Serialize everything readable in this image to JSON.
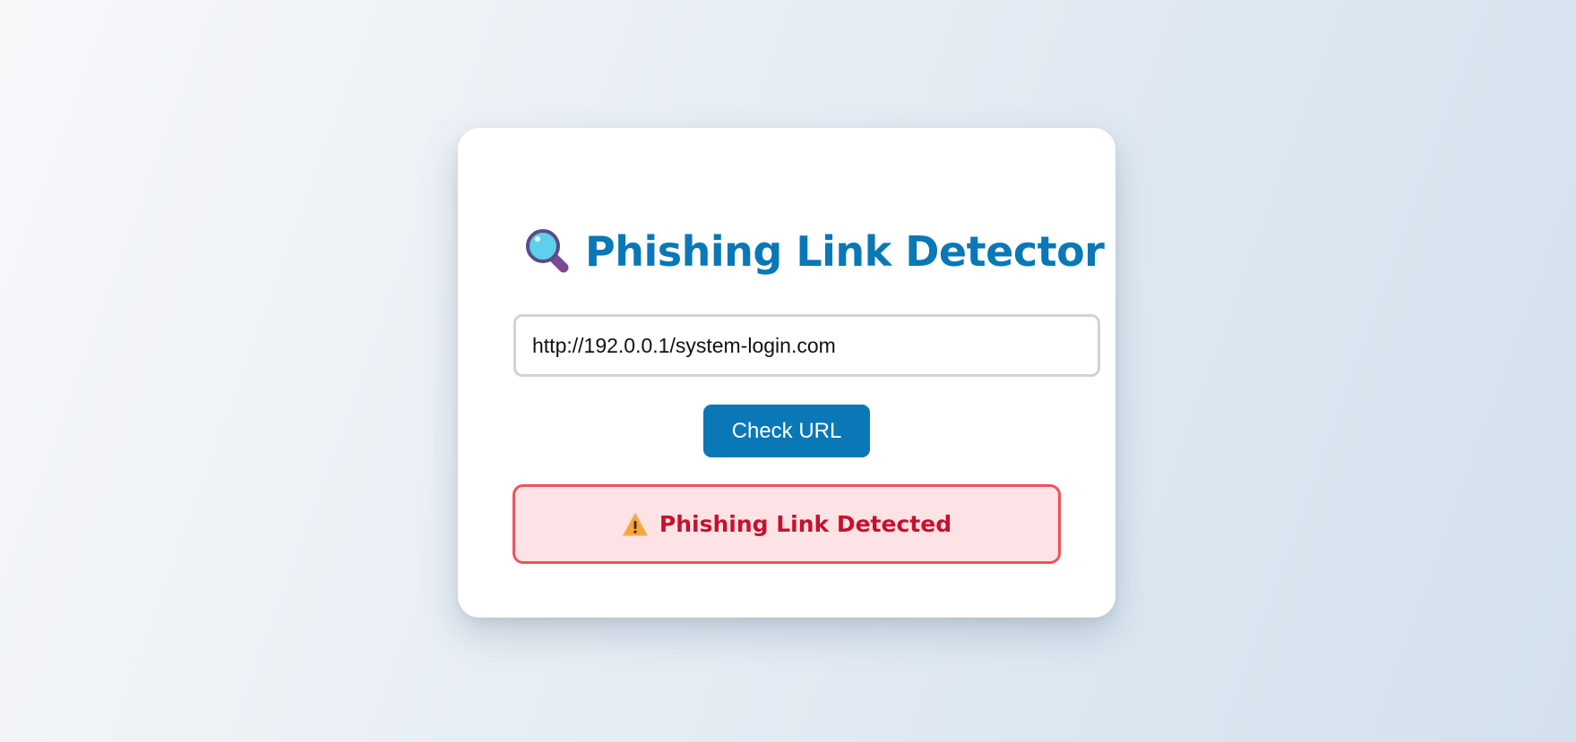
{
  "title": {
    "icon": "magnifying-glass-icon",
    "text": "Phishing Link Detector"
  },
  "url_input": {
    "value": "http://192.0.0.1/system-login.com"
  },
  "check_button": {
    "label": "Check URL"
  },
  "result": {
    "icon": "warning-icon",
    "text": "Phishing Link Detected"
  },
  "colors": {
    "accent": "#0a77b7",
    "danger_text": "#c8102e",
    "danger_border": "#ef5358",
    "danger_bg": "#fde3e5"
  }
}
